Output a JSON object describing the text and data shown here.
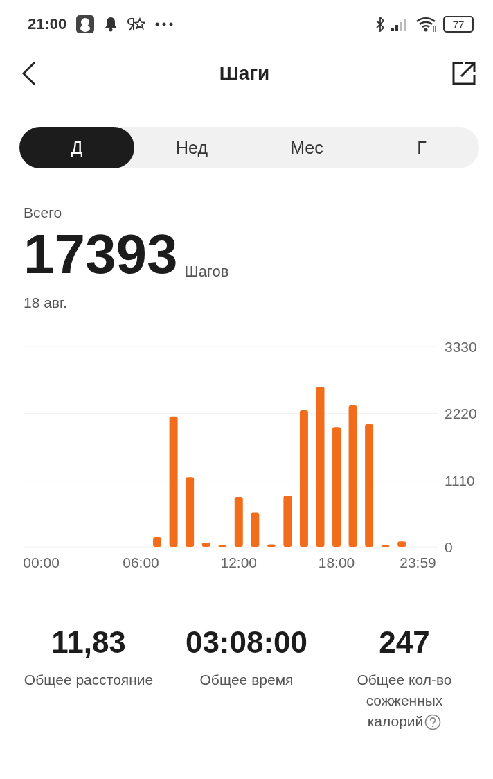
{
  "status_bar": {
    "time": "21:00",
    "battery": "77"
  },
  "header": {
    "title": "Шаги"
  },
  "tabs": [
    {
      "label": "Д",
      "selected": true
    },
    {
      "label": "Нед",
      "selected": false
    },
    {
      "label": "Мес",
      "selected": false
    },
    {
      "label": "Г",
      "selected": false
    }
  ],
  "summary": {
    "label": "Всего",
    "value": "17393",
    "unit": "Шагов",
    "date": "18 авг."
  },
  "chart_data": {
    "type": "bar",
    "x": [
      7,
      8,
      9,
      10,
      11,
      12,
      13,
      14,
      15,
      16,
      17,
      18,
      19,
      20,
      21,
      22
    ],
    "series": [
      {
        "color": "#f26d1b",
        "values": [
          160,
          2170,
          1160,
          70,
          10,
          830,
          570,
          40,
          850,
          2270,
          2660,
          1990,
          2350,
          2040,
          10,
          90
        ]
      }
    ],
    "xlim": [
      -1.2,
      24.2
    ],
    "ylim": [
      0,
      3330
    ],
    "xticks": [
      {
        "value": 0,
        "label": "00:00"
      },
      {
        "value": 6,
        "label": "06:00"
      },
      {
        "value": 12,
        "label": "12:00"
      },
      {
        "value": 18,
        "label": "18:00"
      },
      {
        "value": 23.98,
        "label": "23:59"
      }
    ],
    "yticks": [
      0,
      1110,
      2220,
      3330
    ]
  },
  "stats": [
    {
      "value": "11,83",
      "label": "Общее расстояние",
      "help": false
    },
    {
      "value": "03:08:00",
      "label": "Общее время",
      "help": false
    },
    {
      "value": "247",
      "label": "Общее кол-во сожженных калорий",
      "help": true
    }
  ]
}
